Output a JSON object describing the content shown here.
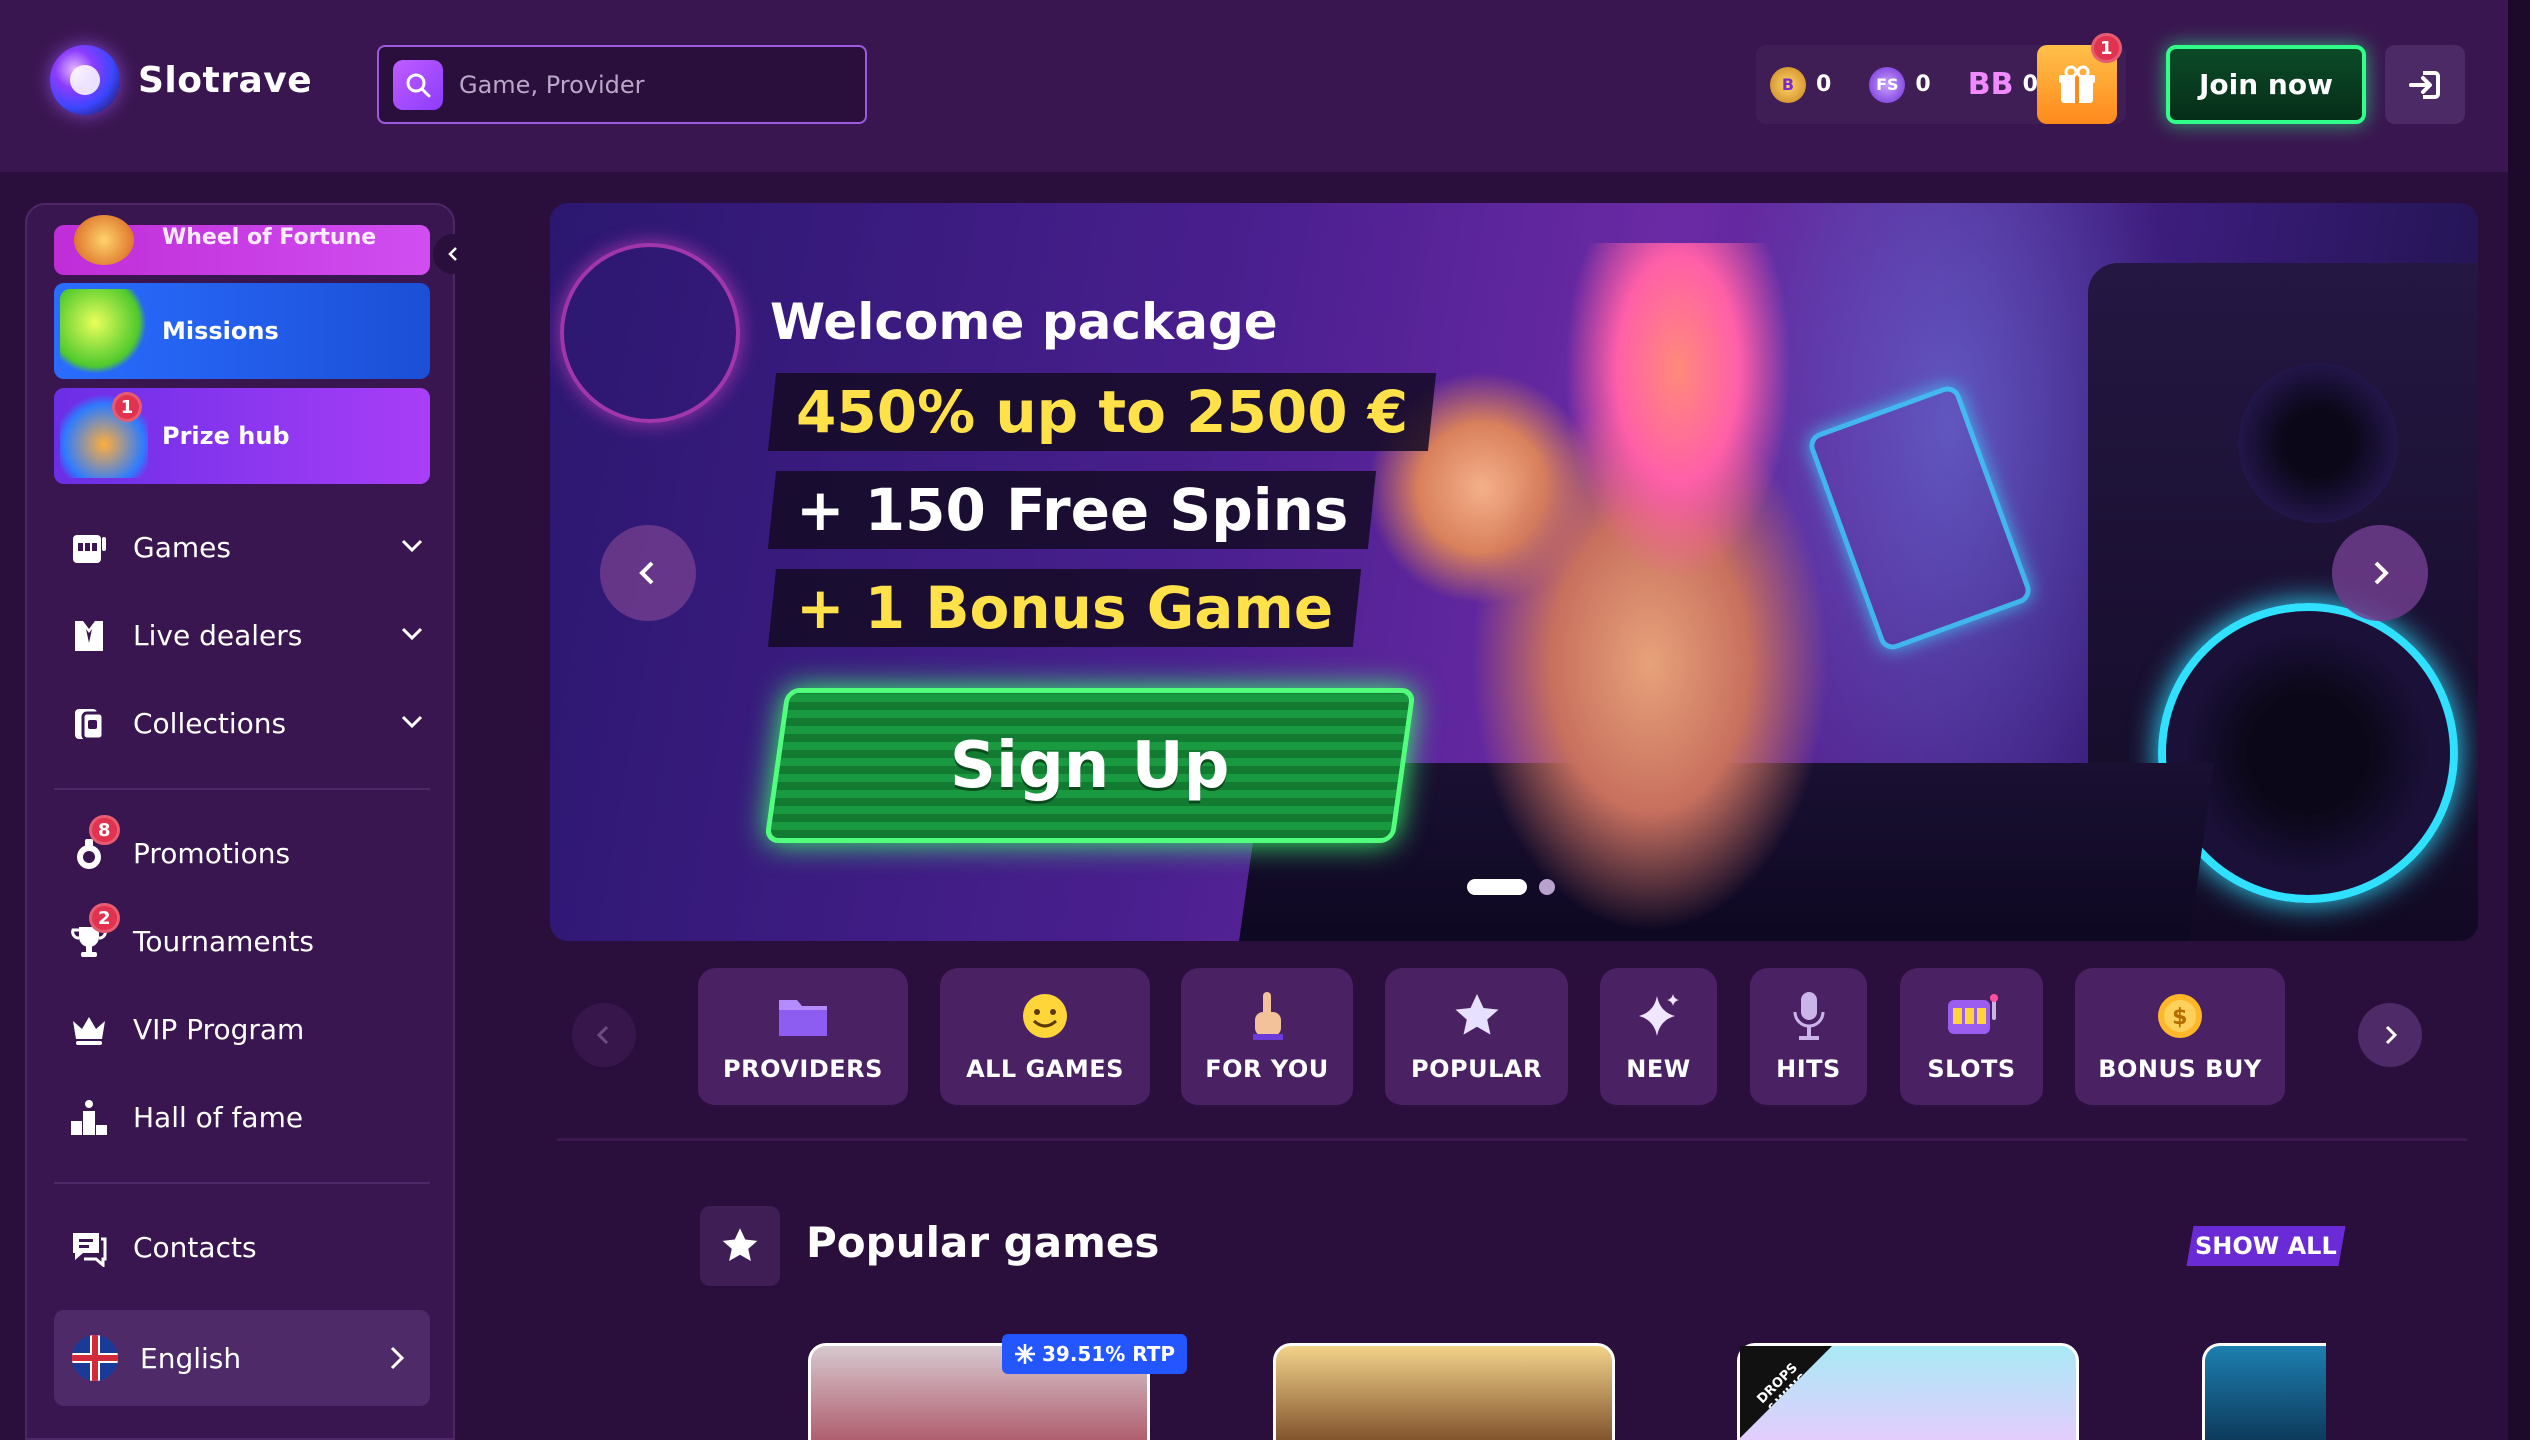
{
  "header": {
    "logo_text": "Slotrave",
    "search_placeholder": "Game, Provider",
    "wallet": {
      "coins": "0",
      "free_spins_label": "FS",
      "free_spins": "0",
      "bonus_buy_label": "BB",
      "bonus_buy": "0"
    },
    "gift_badge": "1",
    "join_label": "Join now"
  },
  "sidebar": {
    "wheel_label": "Wheel of Fortune",
    "missions_label": "Missions",
    "prize_hub_label": "Prize hub",
    "prize_hub_badge": "1",
    "items": [
      {
        "label": "Games",
        "icon": "games-icon"
      },
      {
        "label": "Live dealers",
        "icon": "live-dealers-icon"
      },
      {
        "label": "Collections",
        "icon": "collections-icon"
      },
      {
        "label": "Promotions",
        "icon": "promotions-icon",
        "badge": "8"
      },
      {
        "label": "Tournaments",
        "icon": "trophy-icon",
        "badge": "2"
      },
      {
        "label": "VIP Program",
        "icon": "crown-icon"
      },
      {
        "label": "Hall of fame",
        "icon": "podium-icon"
      },
      {
        "label": "Contacts",
        "icon": "chat-icon"
      }
    ],
    "language": "English"
  },
  "banner": {
    "title": "Welcome package",
    "line1": "450% up to 2500 €",
    "line2": "+ 150 Free Spins",
    "line3": "+ 1 Bonus Game",
    "cta": "Sign Up",
    "slides": 2,
    "active_slide": 1
  },
  "categories": [
    {
      "label": "PROVIDERS",
      "icon": "folder-icon"
    },
    {
      "label": "ALL GAMES",
      "icon": "smiley-icon"
    },
    {
      "label": "FOR YOU",
      "icon": "pointing-hand-icon"
    },
    {
      "label": "POPULAR",
      "icon": "star-icon"
    },
    {
      "label": "NEW",
      "icon": "sparkle-icon"
    },
    {
      "label": "HITS",
      "icon": "microphone-icon"
    },
    {
      "label": "SLOTS",
      "icon": "slot-machine-icon"
    },
    {
      "label": "BONUS BUY",
      "icon": "coin-icon"
    }
  ],
  "popular": {
    "title": "Popular games",
    "show_all": "SHOW ALL",
    "rtp_badge": "39.51% RTP",
    "drops_badge": "DROPS &WINS"
  },
  "colors": {
    "background": "#2a0f3c",
    "header": "#3a1650",
    "accent_purple": "#8b3cff",
    "join_green": "#30ff8a",
    "banner_yellow": "#ffe14a"
  }
}
